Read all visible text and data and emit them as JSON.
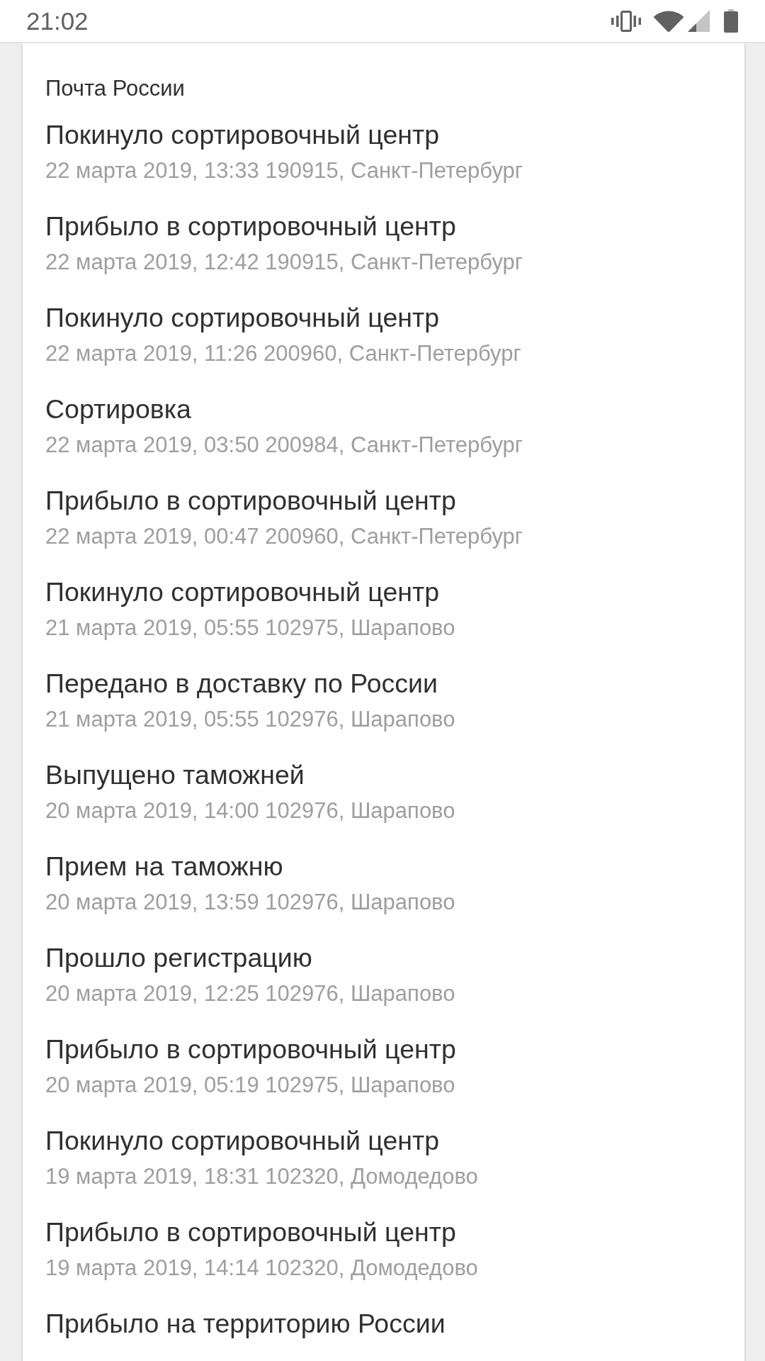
{
  "status_bar": {
    "time": "21:02"
  },
  "card": {
    "carrier": "Почта России",
    "events": [
      {
        "status": "Покинуло сортировочный центр",
        "details": "22 марта 2019, 13:33 190915, Санкт-Петербург"
      },
      {
        "status": "Прибыло в сортировочный центр",
        "details": "22 марта 2019, 12:42 190915, Санкт-Петербург"
      },
      {
        "status": "Покинуло сортировочный центр",
        "details": "22 марта 2019, 11:26 200960, Санкт-Петербург"
      },
      {
        "status": "Сортировка",
        "details": "22 марта 2019, 03:50 200984, Санкт-Петербург"
      },
      {
        "status": "Прибыло в сортировочный центр",
        "details": "22 марта 2019, 00:47 200960, Санкт-Петербург"
      },
      {
        "status": "Покинуло сортировочный центр",
        "details": "21 марта 2019, 05:55 102975, Шарапово"
      },
      {
        "status": "Передано в доставку по России",
        "details": "21 марта 2019, 05:55 102976, Шарапово"
      },
      {
        "status": "Выпущено таможней",
        "details": "20 марта 2019, 14:00 102976, Шарапово"
      },
      {
        "status": "Прием на таможню",
        "details": "20 марта 2019, 13:59 102976, Шарапово"
      },
      {
        "status": "Прошло регистрацию",
        "details": "20 марта 2019, 12:25 102976, Шарапово"
      },
      {
        "status": "Прибыло в сортировочный центр",
        "details": "20 марта 2019, 05:19 102975, Шарапово"
      },
      {
        "status": "Покинуло сортировочный центр",
        "details": "19 марта 2019, 18:31 102320, Домодедово"
      },
      {
        "status": "Прибыло в сортировочный центр",
        "details": "19 марта 2019, 14:14 102320, Домодедово"
      },
      {
        "status": "Прибыло на территорию России"
      }
    ]
  }
}
